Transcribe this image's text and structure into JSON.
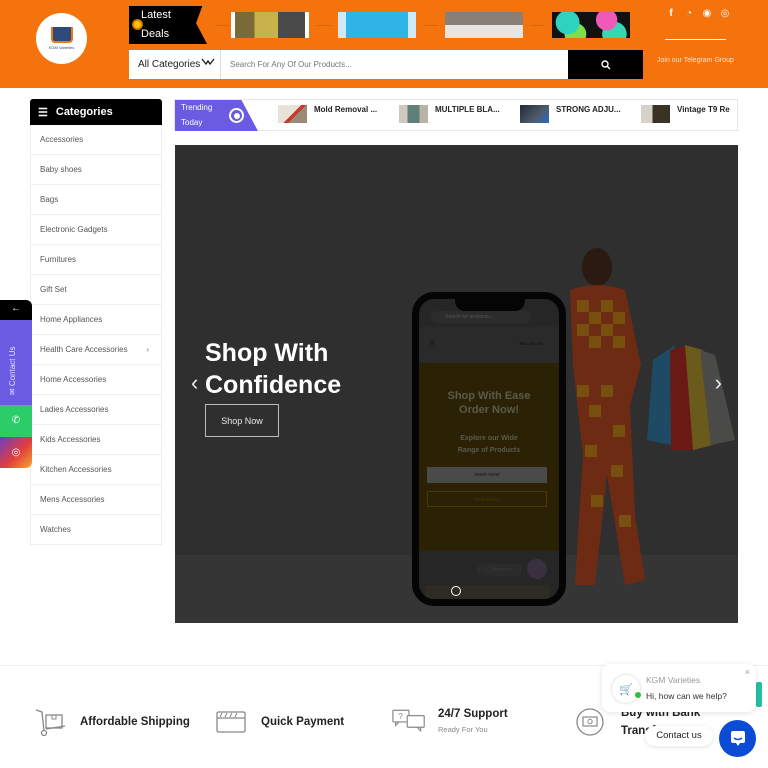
{
  "header": {
    "logo_text": "KGM Varieties",
    "latest_deals": {
      "line1": "Latest",
      "line2": "Deals"
    },
    "deal_thumbs": [
      {
        "name": "deal-thumb-1",
        "color": "#7a6a3a"
      },
      {
        "name": "deal-thumb-2",
        "color": "#2fb4e8"
      },
      {
        "name": "deal-thumb-3",
        "color": "#6f6a65"
      },
      {
        "name": "deal-thumb-4",
        "color": "#1c1c1c"
      }
    ],
    "category_select": {
      "value": "All Categories",
      "chevron": "⌄"
    },
    "search": {
      "placeholder": "Search For Any Of Our Products...",
      "button_icon": "search-icon"
    },
    "socials": [
      "f",
      "◔",
      "◉",
      "◎"
    ],
    "telegram_text": "Join our Telegram Group"
  },
  "categories": {
    "title": "Categories",
    "items": [
      {
        "label": "Accessories"
      },
      {
        "label": "Baby shoes"
      },
      {
        "label": "Bags"
      },
      {
        "label": "Electronic Gadgets"
      },
      {
        "label": "Furnitures"
      },
      {
        "label": "Gift Set"
      },
      {
        "label": "Home Appliances"
      },
      {
        "label": "Health Care Accessories",
        "arrow": "›"
      },
      {
        "label": "Home Accessories"
      },
      {
        "label": "Ladies Accessories"
      },
      {
        "label": "Kids Accessories"
      },
      {
        "label": "Kitchen Accessories"
      },
      {
        "label": "Mens Accessories"
      },
      {
        "label": "Watches"
      }
    ]
  },
  "trending": {
    "label1": "Trending",
    "label2": "Today",
    "items": [
      {
        "name": "Mold Removal ..."
      },
      {
        "name": "MULTIPLE BLA..."
      },
      {
        "name": "STRONG ADJU..."
      },
      {
        "name": "Vintage T9 Re"
      }
    ]
  },
  "hero": {
    "title_line1": "Shop With",
    "title_line2": "Confidence",
    "button": "Shop Now",
    "prev": "‹",
    "next": "›",
    "phone": {
      "search_placeholder": "Search for products...",
      "price": "₦62,000.00",
      "banner_title1": "Shop With Ease",
      "banner_title2": "Order Now!",
      "banner_sub1": "Explore our Wide",
      "banner_sub2": "Range of Products",
      "btn_shop": "SHOP NOW",
      "btn_find": "FIND MORE",
      "contact": "Contact us"
    }
  },
  "float_bar": {
    "back": "←",
    "contact": "✉ Contact Us",
    "whatsapp": "✆",
    "instagram": "◎"
  },
  "features": [
    {
      "title": "Affordable Shipping",
      "sub": ""
    },
    {
      "title": "Quick Payment",
      "sub": ""
    },
    {
      "title": "24/7 Support",
      "sub": "Ready For You"
    },
    {
      "title": "Buy with Bank",
      "sub": "Transfer"
    }
  ],
  "chat": {
    "name": "KGM Varieties",
    "message": "Hi, how can we help?",
    "close": "×",
    "contact_label": "Contact us"
  },
  "colors": {
    "brand": "#f5730c",
    "accent": "#6a5be2",
    "chat": "#0b4bd6"
  }
}
